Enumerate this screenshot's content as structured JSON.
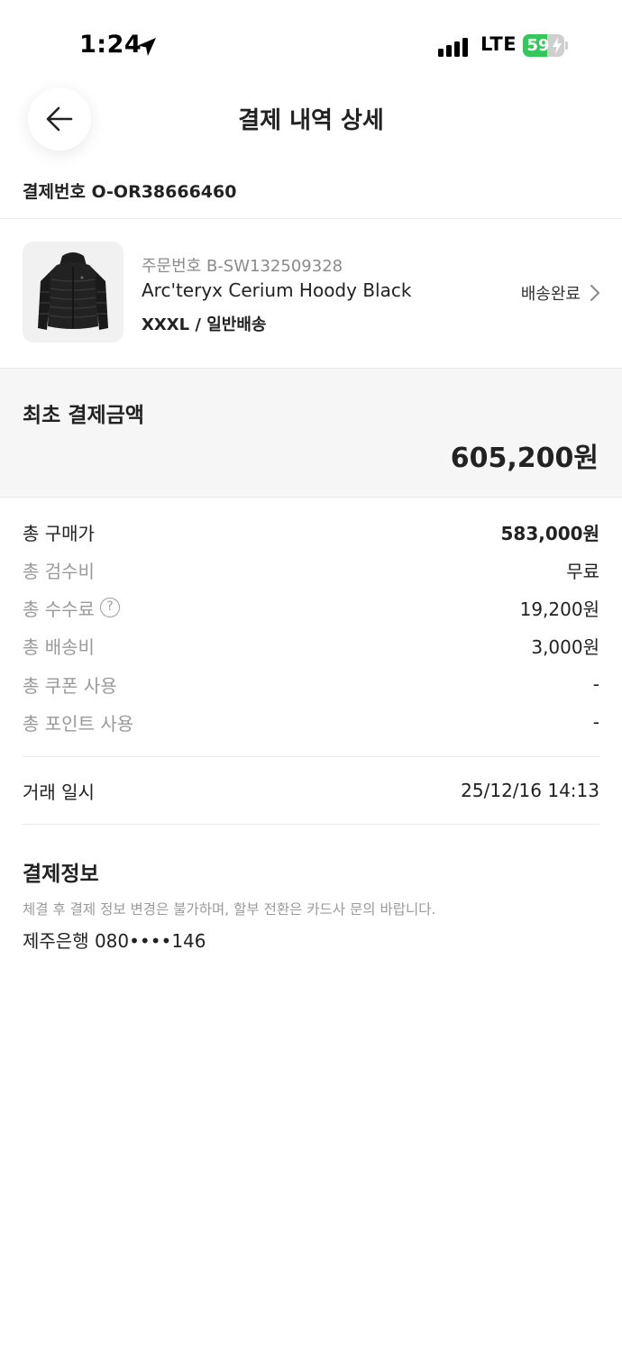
{
  "status_bar": {
    "time": "1:24",
    "network": "LTE",
    "battery_percent": "59",
    "battery_level": 0.59,
    "icons": [
      "location-arrow-icon",
      "signal-icon",
      "battery-charging-icon"
    ]
  },
  "header": {
    "title": "결제 내역 상세",
    "back_icon": "arrow-left-icon"
  },
  "payment_number": "결제번호 O-OR38666460",
  "product": {
    "order_number": "주문번호 B-SW132509328",
    "name": "Arc'teryx Cerium Hoody Black",
    "option": "XXXL / 일반배송",
    "status": "배송완료",
    "image_icon": "black-down-jacket-image"
  },
  "initial_payment": {
    "label": "최초 결제금액",
    "amount": "605,200원"
  },
  "summary": [
    {
      "label": "총 구매가",
      "value": "583,000원"
    },
    {
      "label": "총 검수비",
      "value": "무료"
    },
    {
      "label": "총 수수료",
      "value": "19,200원",
      "help": "?"
    },
    {
      "label": "총 배송비",
      "value": "3,000원"
    },
    {
      "label": "총 쿠폰 사용",
      "value": "-"
    },
    {
      "label": "총 포인트 사용",
      "value": "-"
    }
  ],
  "transaction": {
    "label": "거래 일시",
    "value": "25/12/16 14:13"
  },
  "payment_info": {
    "title": "결제정보",
    "notice": "체결 후 결제 정보 변경은 불가하며, 할부 전환은 카드사 문의 바랍니다.",
    "method": "제주은행 080••••146"
  }
}
